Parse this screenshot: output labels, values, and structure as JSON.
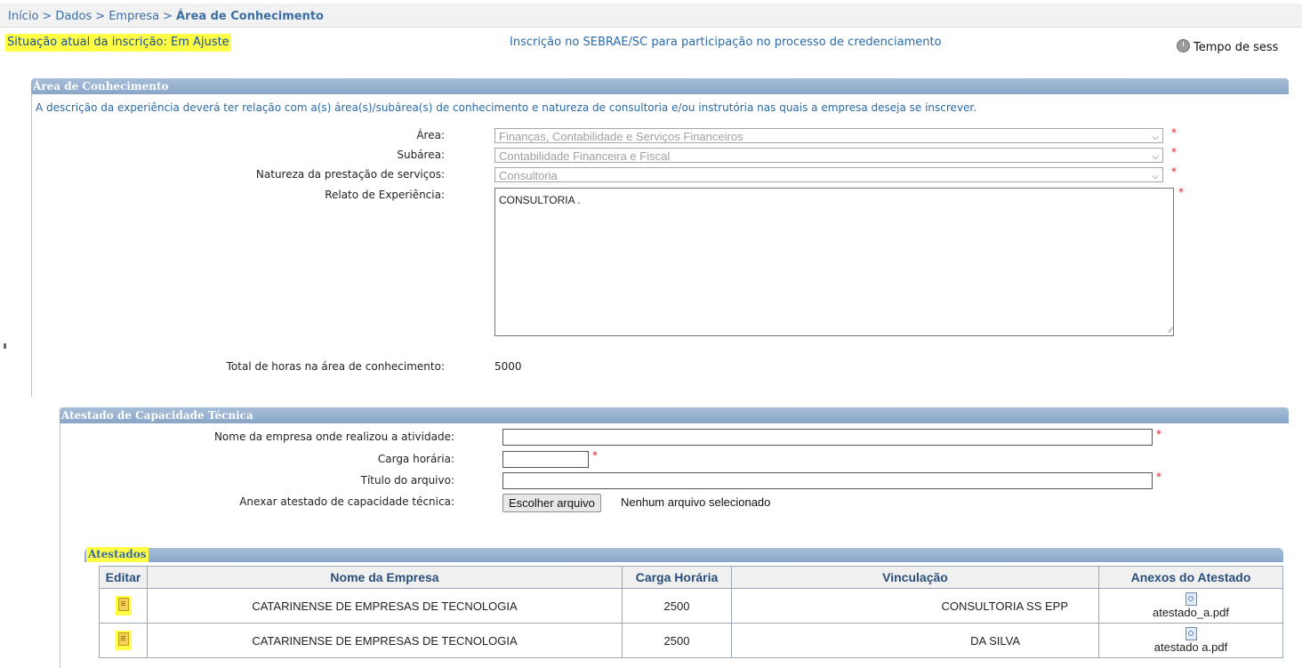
{
  "breadcrumb": {
    "items": [
      "Início",
      "Dados",
      "Empresa"
    ],
    "separator": ">",
    "current": "Área de Conhecimento"
  },
  "status_line": "Situação atual da inscrição: Em Ajuste",
  "page_subtitle": "Inscrição no SEBRAE/SC para participação no processo de credenciamento",
  "session_label": "Tempo de sess",
  "area_section": {
    "title": "Área de Conhecimento",
    "description": "A descrição da experiência deverá ter relação com a(s) área(s)/subárea(s) de conhecimento e natureza de consultoria e/ou instrutória nas quais a empresa deseja se inscrever.",
    "area_label": "Área:",
    "area_value": "Finanças, Contabilidade e Serviços Financeiros",
    "subarea_label": "Subárea:",
    "subarea_value": "Contabilidade Financeira e Fiscal",
    "natureza_label": "Natureza da prestação de serviços:",
    "natureza_value": "Consultoria",
    "relato_label": "Relato de Experiência:",
    "relato_value": "CONSULTORIA .",
    "total_label": "Total de horas na área de conhecimento:",
    "total_value": "5000",
    "required_mark": "*"
  },
  "atestado_section": {
    "title": "Atestado de Capacidade Técnica",
    "empresa_label": "Nome da empresa onde realizou a atividade:",
    "carga_label": "Carga horária:",
    "titulo_label": "Título do arquivo:",
    "anexar_label": "Anexar atestado de capacidade técnica:",
    "file_button": "Escolher arquivo",
    "file_status": "Nenhum arquivo selecionado"
  },
  "atestados_table": {
    "title": "Atestados",
    "columns": [
      "Editar",
      "Nome da Empresa",
      "Carga Horária",
      "Vinculação",
      "Anexos do Atestado"
    ],
    "rows": [
      {
        "empresa": "CATARINENSE DE EMPRESAS DE TECNOLOGIA",
        "carga": "2500",
        "vinculacao": "CONSULTORIA SS EPP",
        "anexo": "atestado_a.pdf"
      },
      {
        "empresa": "CATARINENSE DE EMPRESAS DE TECNOLOGIA",
        "carga": "2500",
        "vinculacao": "DA SILVA",
        "anexo": "atestado a.pdf"
      }
    ]
  },
  "colors": {
    "highlight": "#ffff46",
    "link_blue": "#2a6aa8",
    "section_bar": "#8aa6c8",
    "required": "#e21b1b"
  }
}
